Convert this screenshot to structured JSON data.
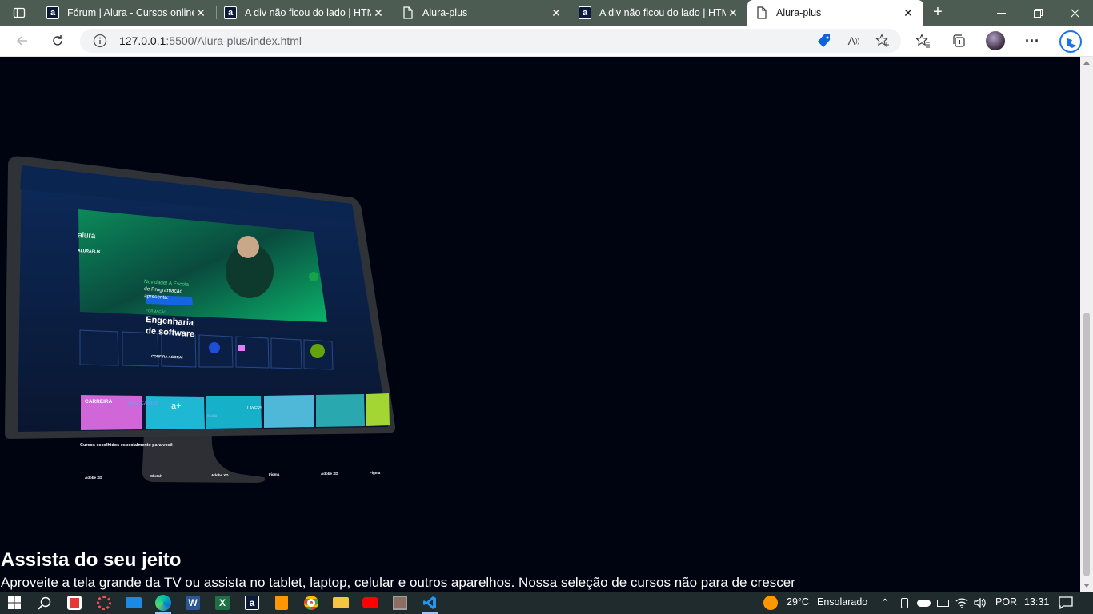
{
  "browser": {
    "tabs": [
      {
        "title": "Fórum | Alura - Cursos online",
        "favicon": "alura-icon"
      },
      {
        "title": "A div não ficou do lado | HTM",
        "favicon": "alura-icon"
      },
      {
        "title": "Alura-plus",
        "favicon": "page-icon"
      },
      {
        "title": "A div não ficou do lado | HTM",
        "favicon": "alura-icon"
      },
      {
        "title": "Alura-plus",
        "favicon": "page-icon"
      }
    ],
    "active_tab_index": 4,
    "url_host": "127.0.0.1",
    "url_path": ":5500/Alura-plus/index.html"
  },
  "page": {
    "heading": "Assista do seu jeito",
    "subtext": "Aproveite a tela grande da TV ou assista no tablet, laptop, celular e outros aparelhos. Nossa seleção de cursos não para de crescer",
    "tv_mock": {
      "brand": "alura",
      "section": "ALURAFLIX",
      "banner_lines": [
        "Novidade! A Escola",
        "de Programação",
        "apresenta:"
      ],
      "banner_tag": "FORMAÇÃO",
      "banner_title": [
        "Engenharia",
        "de software"
      ],
      "banner_button": "CONFIRA AGORA!",
      "categories": [
        "CARREIRA",
        "alura CASES",
        "a+",
        "SCUBA",
        "LAYERS",
        "",
        ""
      ],
      "courses_heading": "Cursos escolhidos especialmente para você",
      "courses": [
        "Adobe XD",
        "Sketch",
        "Adobe XD",
        "Figma",
        "Adobe XD",
        "Figma"
      ]
    }
  },
  "taskbar": {
    "temperature": "29°C",
    "weather": "Ensolarado",
    "language": "POR",
    "time": "13:31"
  },
  "colors": {
    "page_bg": "#000310",
    "tab_strip": "#4d5c52",
    "taskbar": "#1f2b2d"
  }
}
